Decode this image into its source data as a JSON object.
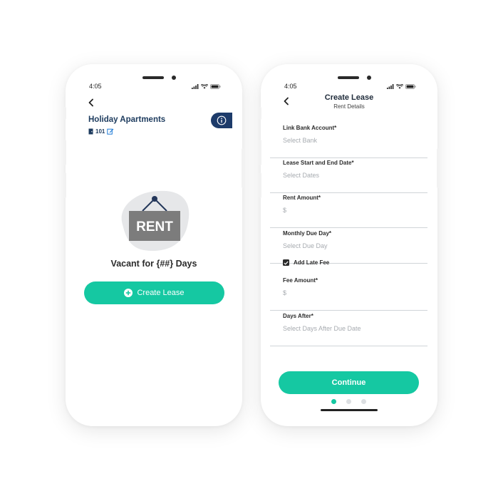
{
  "colors": {
    "accent": "#15c8a2",
    "navy": "#1d3b5e",
    "placeholder": "#a7abb0"
  },
  "screen1": {
    "time": "4:05",
    "property_title": "Holiday Apartments",
    "unit_number": "101",
    "illustration_sign": "RENT",
    "vacant_text": "Vacant for {##} Days",
    "create_lease_label": "Create Lease"
  },
  "screen2": {
    "time": "4:05",
    "title": "Create Lease",
    "subtitle": "Rent Details",
    "fields": [
      {
        "label": "Link Bank Account*",
        "placeholder": "Select Bank"
      },
      {
        "label": "Lease Start and End Date*",
        "placeholder": "Select Dates"
      },
      {
        "label": "Rent Amount*",
        "placeholder": "$"
      },
      {
        "label": "Monthly Due Day*",
        "placeholder": "Select Due Day"
      },
      {
        "label": "Fee Amount*",
        "placeholder": "$"
      },
      {
        "label": "Days After*",
        "placeholder": "Select Days After Due Date"
      }
    ],
    "late_fee_label": "Add Late Fee",
    "late_fee_checked": true,
    "continue_label": "Continue",
    "pagination": {
      "total": 3,
      "current": 1
    }
  }
}
